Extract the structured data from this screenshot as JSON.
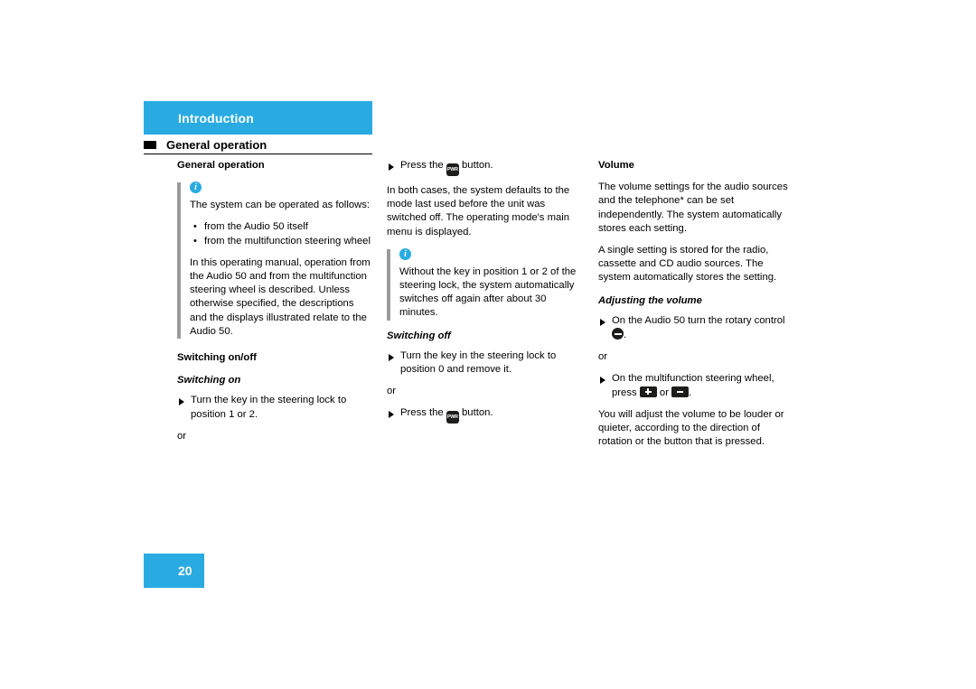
{
  "header": {
    "chapter_title": "Introduction",
    "section_title": "General operation",
    "accent_color": "#29ABE2"
  },
  "page_number": "20",
  "columns": {
    "col1": {
      "heading": "General operation",
      "callout_icon": "i",
      "callout_intro": "The system can be operated as follows:",
      "bullets": [
        "from the Audio 50 itself",
        "from the multifunction steering wheel"
      ],
      "callout_paragraph": "In this operating manual, operation from the Audio 50 and from the multifunction steering wheel is described. Unless otherwise specified, the descriptions and the displays illustrated relate to the Audio 50.",
      "subhead_switching": "Switching on/off",
      "italic_switching_on": "Switching on",
      "step_turn_key": "Turn the key in the steering lock to position 1 or 2.",
      "or": "or"
    },
    "col2": {
      "step_press_1_pre": "Press the",
      "step_press_1_post": "button.",
      "paragraph_defaults": "In both cases, the system defaults to the mode last used before the unit was switched off. The operating mode's main menu is displayed.",
      "callout_icon": "i",
      "callout_text": "Without the key in position 1 or 2 of the steering lock, the system automatically switches off again after about 30 minutes.",
      "italic_switching_off": "Switching off",
      "step_turn_key_off": "Turn the key in the steering lock to position 0 and remove it.",
      "or": "or",
      "step_press_2_pre": "Press the",
      "step_press_2_post": "button."
    },
    "col3": {
      "heading": "Volume",
      "paragraph_1": "The volume settings for the audio sources and the telephone* can be set independently. The system automatically stores each setting.",
      "paragraph_2": "A single setting is stored for the radio, cassette and CD audio sources. The system automatically stores the setting.",
      "italic_adjusting": "Adjusting the volume",
      "step_rotary_pre": "On the Audio 50 turn the rotary control",
      "step_rotary_post": ".",
      "or": "or",
      "step_mfsw_pre": "On the multifunction steering wheel, press",
      "step_mfsw_mid": "or",
      "step_mfsw_post": ".",
      "paragraph_3": "You will adjust the volume to be louder or quieter, according to the direction of rotation or the button that is pressed."
    }
  },
  "icons": {
    "power_button_label": "PWR",
    "rotary_knob": "rotary-knob-icon",
    "volume_up": "plus-button-icon",
    "volume_down": "minus-button-icon"
  }
}
